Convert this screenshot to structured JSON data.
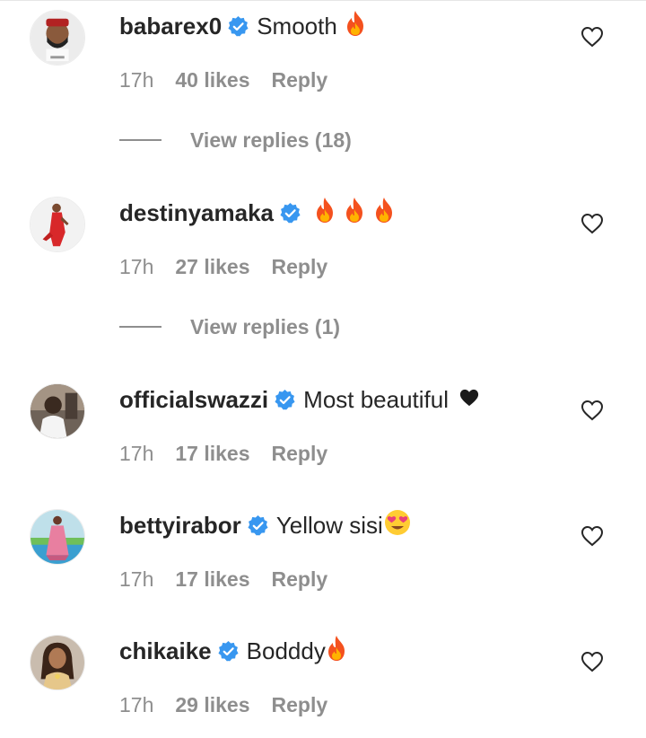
{
  "comments": [
    {
      "username": "babarex0",
      "text": "Smooth",
      "emojis": [
        "fire"
      ],
      "time": "17h",
      "likes": "40 likes",
      "reply": "Reply",
      "verified": true,
      "view_replies": "View replies (18)",
      "avatar_bg": "#d9d9d9"
    },
    {
      "username": "destinyamaka",
      "text": "",
      "emojis": [
        "fire",
        "fire",
        "fire"
      ],
      "time": "17h",
      "likes": "27 likes",
      "reply": "Reply",
      "verified": true,
      "view_replies": "View replies (1)",
      "avatar_bg": "#eeeeee"
    },
    {
      "username": "officialswazzi",
      "text": "Most beautiful",
      "emojis": [
        "black-heart"
      ],
      "time": "17h",
      "likes": "17 likes",
      "reply": "Reply",
      "verified": true,
      "avatar_bg": "#8a7a6a"
    },
    {
      "username": "bettyirabor",
      "text": "Yellow sisi",
      "emojis": [
        "heart-eyes"
      ],
      "time": "17h",
      "likes": "17 likes",
      "reply": "Reply",
      "verified": true,
      "avatar_bg": "#8fc5d8"
    },
    {
      "username": "chikaike",
      "text": "Bodddy",
      "emojis": [
        "fire"
      ],
      "time": "17h",
      "likes": "29 likes",
      "reply": "Reply",
      "verified": true,
      "avatar_bg": "#b8a89a"
    }
  ],
  "colors": {
    "text": "#262626",
    "muted": "#8e8e8e",
    "verified": "#3897f0"
  }
}
